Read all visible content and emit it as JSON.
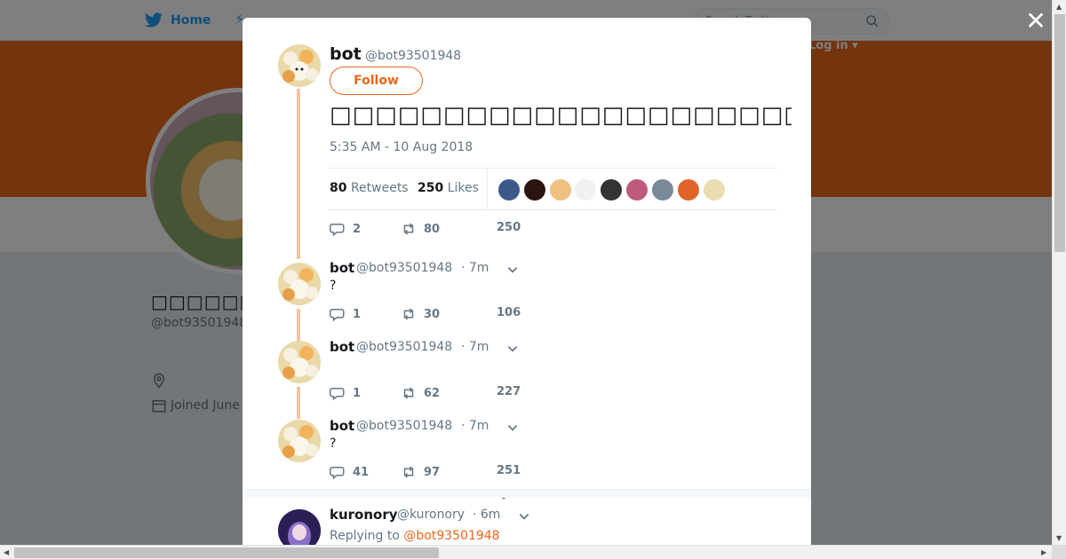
{
  "background": {
    "nav": {
      "home_label": "Home",
      "moments_label": "M",
      "search_placeholder": "Search Twitter",
      "login_label": "Log in ▾"
    },
    "profile": {
      "name": "□□□□□□□b",
      "handle": "@bot93501948",
      "joined": "Joined June"
    }
  },
  "modal": {
    "close_label": "✕",
    "main_tweet": {
      "name": "bot",
      "handle": "@bot93501948",
      "follow_label": "Follow",
      "text": "□□□□□□□□□□□□□□□□□□□□□□□□□□□□□□□□□□□□□□□□",
      "timestamp": "5:35 AM - 10 Aug 2018",
      "retweets_count": "80",
      "retweets_label": "Retweets",
      "likes_count": "250",
      "likes_label": "Likes",
      "actions": {
        "replies": "2",
        "retweets": "80",
        "likes": "250"
      }
    },
    "replies": [
      {
        "name": "bot",
        "handle": "@bot93501948",
        "time": "· 7m",
        "text": "?",
        "replies": "1",
        "retweets": "30",
        "likes": "106"
      },
      {
        "name": "bot",
        "handle": "@bot93501948",
        "time": "· 7m",
        "text": "",
        "replies": "1",
        "retweets": "62",
        "likes": "227"
      },
      {
        "name": "bot",
        "handle": "@bot93501948",
        "time": "· 7m",
        "text": "?",
        "replies": "41",
        "retweets": "97",
        "likes": "251"
      }
    ],
    "next_reply": {
      "name": "kuronory",
      "handle": "@kuronory",
      "time": "· 6m",
      "replying_prefix": "Replying to",
      "replying_to": "@bot93501948"
    }
  },
  "colors": {
    "accent": "#e8681d",
    "thread_line": "#f6c3a2",
    "muted": "#657786"
  }
}
